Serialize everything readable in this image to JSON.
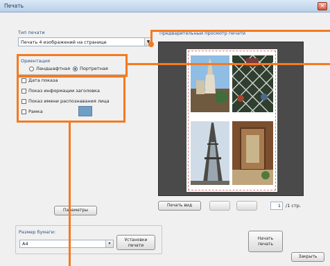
{
  "window": {
    "title": "Печать",
    "close_glyph": "×"
  },
  "print_type": {
    "label": "Тип печати",
    "value": "Печать 4 изображений на странице"
  },
  "preview": {
    "label": "Предварительный просмотр печати"
  },
  "orientation": {
    "label": "Ориентация",
    "options": [
      {
        "label": "Ландшафтная",
        "selected": false
      },
      {
        "label": "Портретная",
        "selected": true
      }
    ]
  },
  "options": {
    "items": [
      {
        "label": "Дата показа",
        "checked": false
      },
      {
        "label": "Показ информации заголовка",
        "checked": false
      },
      {
        "label": "Показ имени распознавания лица",
        "checked": false
      },
      {
        "label": "Рамка",
        "checked": false
      }
    ],
    "frame_color": "#6f9fc4"
  },
  "buttons": {
    "options": "Параметры",
    "print_page": "Печать вид",
    "prev": "",
    "next": "",
    "setup": "Установки печати",
    "print": "Начать печать",
    "close": "Закрыть"
  },
  "pager": {
    "current": "1",
    "total": "/1 стр."
  },
  "paper": {
    "label": "Размер бумаги:",
    "value": "A4"
  },
  "icons": {
    "combo_arrow": "▼",
    "combo_arrow_small": "▾"
  }
}
